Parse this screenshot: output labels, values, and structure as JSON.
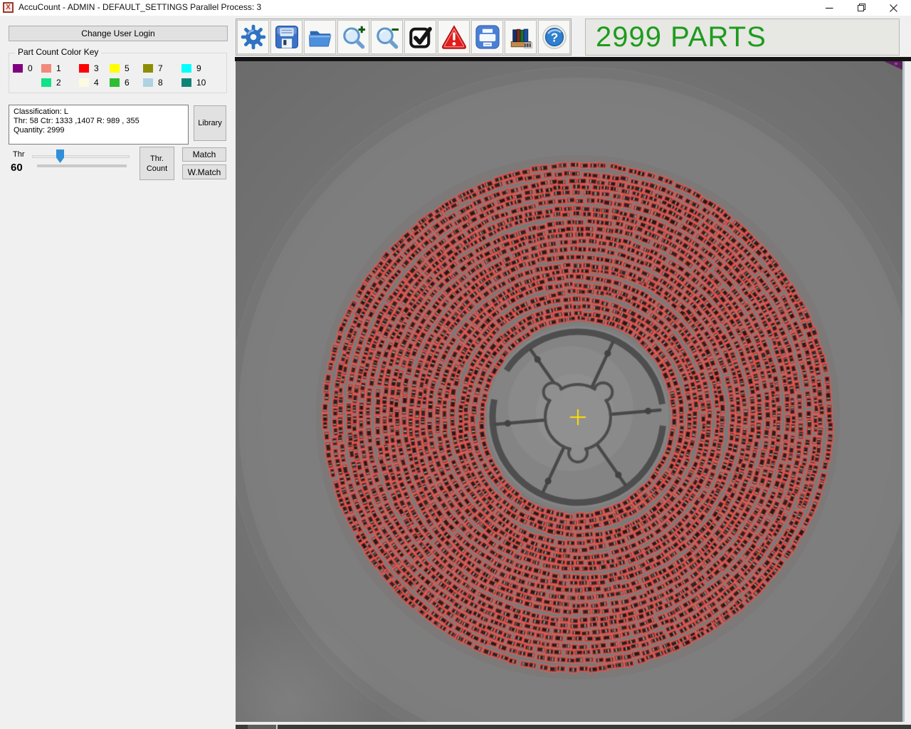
{
  "window": {
    "title": "AccuCount - ADMIN - DEFAULT_SETTINGS Parallel Process: 3",
    "app_icon_glyph": "X"
  },
  "sidebar": {
    "change_user_login": "Change User Login",
    "color_key": {
      "title": "Part Count Color Key",
      "layout": [
        0,
        1,
        3,
        5,
        7,
        9,
        null,
        2,
        4,
        6,
        8,
        10
      ],
      "entries": [
        {
          "label": "0",
          "color": "#800080"
        },
        {
          "label": "1",
          "color": "#f2897b"
        },
        {
          "label": "2",
          "color": "#0fe287"
        },
        {
          "label": "3",
          "color": "#ff0000"
        },
        {
          "label": "4",
          "color": "#fbfbe3"
        },
        {
          "label": "5",
          "color": "#ffff00"
        },
        {
          "label": "6",
          "color": "#2fbd33"
        },
        {
          "label": "7",
          "color": "#8d8d04"
        },
        {
          "label": "8",
          "color": "#aed2e2"
        },
        {
          "label": "9",
          "color": "#00ffff"
        },
        {
          "label": "10",
          "color": "#0e8478"
        }
      ]
    },
    "classification_box": {
      "line1": "Classification: L",
      "line2": "Thr: 58 Ctr: 1333 ,1407 R: 989 , 355",
      "line3": "Quantity: 2999"
    },
    "library_button": "Library",
    "threshold": {
      "label": "Thr",
      "value": "60",
      "slider_pos": 0.27
    },
    "thr_count_button": "Thr.\nCount",
    "match_button": "Match",
    "wmatch_button": "W.Match"
  },
  "toolbar": {
    "icons": [
      {
        "name": "settings-gear-icon"
      },
      {
        "name": "save-icon"
      },
      {
        "name": "open-folder-icon"
      },
      {
        "name": "zoom-in-icon"
      },
      {
        "name": "zoom-out-icon"
      },
      {
        "name": "count-check-icon"
      },
      {
        "name": "warning-icon"
      },
      {
        "name": "print-icon"
      },
      {
        "name": "library-books-icon"
      },
      {
        "name": "help-icon",
        "glyph": "?"
      }
    ],
    "parts_label": "2999 PARTS",
    "parts_color": "#1e9b1e"
  },
  "viewer": {
    "quantity": 2999,
    "overlay_outline_color": "#e13c37",
    "crosshair_color": "#ffdf00"
  }
}
